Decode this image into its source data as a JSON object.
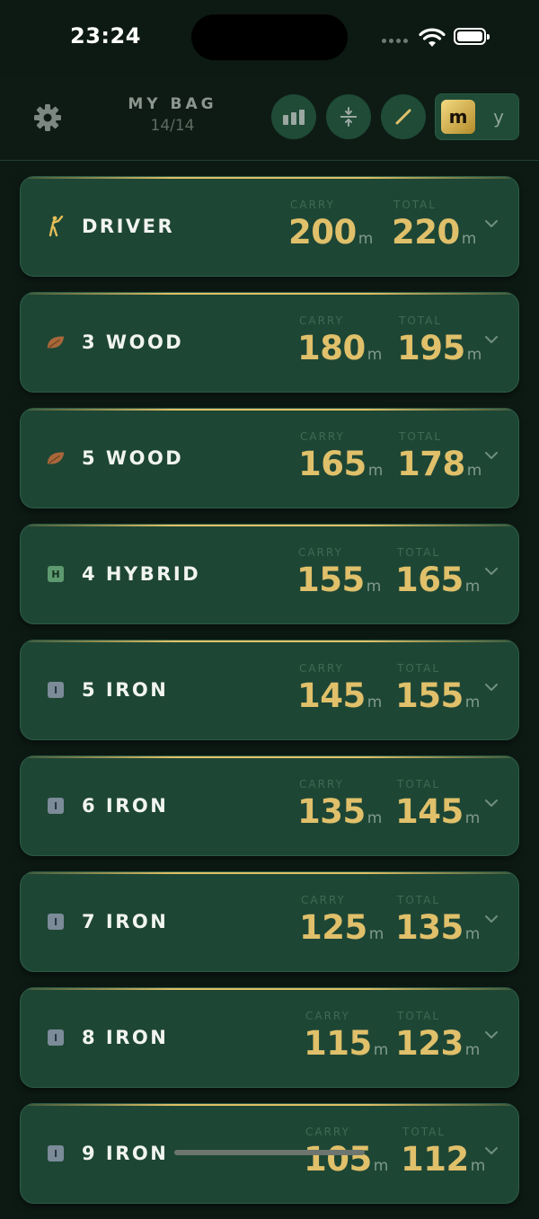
{
  "status_bar": {
    "time": "23:24"
  },
  "header": {
    "title": "MY BAG",
    "count": "14/14",
    "unit_toggle": {
      "metric_label": "m",
      "yard_label": "y",
      "selected": "m"
    }
  },
  "column_labels": {
    "carry": "CARRY",
    "total": "TOTAL"
  },
  "clubs": [
    {
      "name": "DRIVER",
      "icon": "golfer-icon",
      "carry": "200",
      "total": "220",
      "unit": "m"
    },
    {
      "name": "3 WOOD",
      "icon": "wood-leaf-icon",
      "carry": "180",
      "total": "195",
      "unit": "m"
    },
    {
      "name": "5 WOOD",
      "icon": "wood-leaf-icon",
      "carry": "165",
      "total": "178",
      "unit": "m"
    },
    {
      "name": "4 HYBRID",
      "icon": "hybrid-icon",
      "badge": "H",
      "carry": "155",
      "total": "165",
      "unit": "m"
    },
    {
      "name": "5 IRON",
      "icon": "iron-icon",
      "badge": "I",
      "carry": "145",
      "total": "155",
      "unit": "m"
    },
    {
      "name": "6 IRON",
      "icon": "iron-icon",
      "badge": "I",
      "carry": "135",
      "total": "145",
      "unit": "m"
    },
    {
      "name": "7 IRON",
      "icon": "iron-icon",
      "badge": "I",
      "carry": "125",
      "total": "135",
      "unit": "m"
    },
    {
      "name": "8 IRON",
      "icon": "iron-icon",
      "badge": "I",
      "carry": "115",
      "total": "123",
      "unit": "m"
    },
    {
      "name": "9 IRON",
      "icon": "iron-icon",
      "badge": "I",
      "carry": "105",
      "total": "112",
      "unit": "m"
    }
  ],
  "colors": {
    "background": "#0d1a14",
    "card": "#1e4635",
    "gold": "#e0c06a",
    "accent_button": "#1f4b37"
  }
}
